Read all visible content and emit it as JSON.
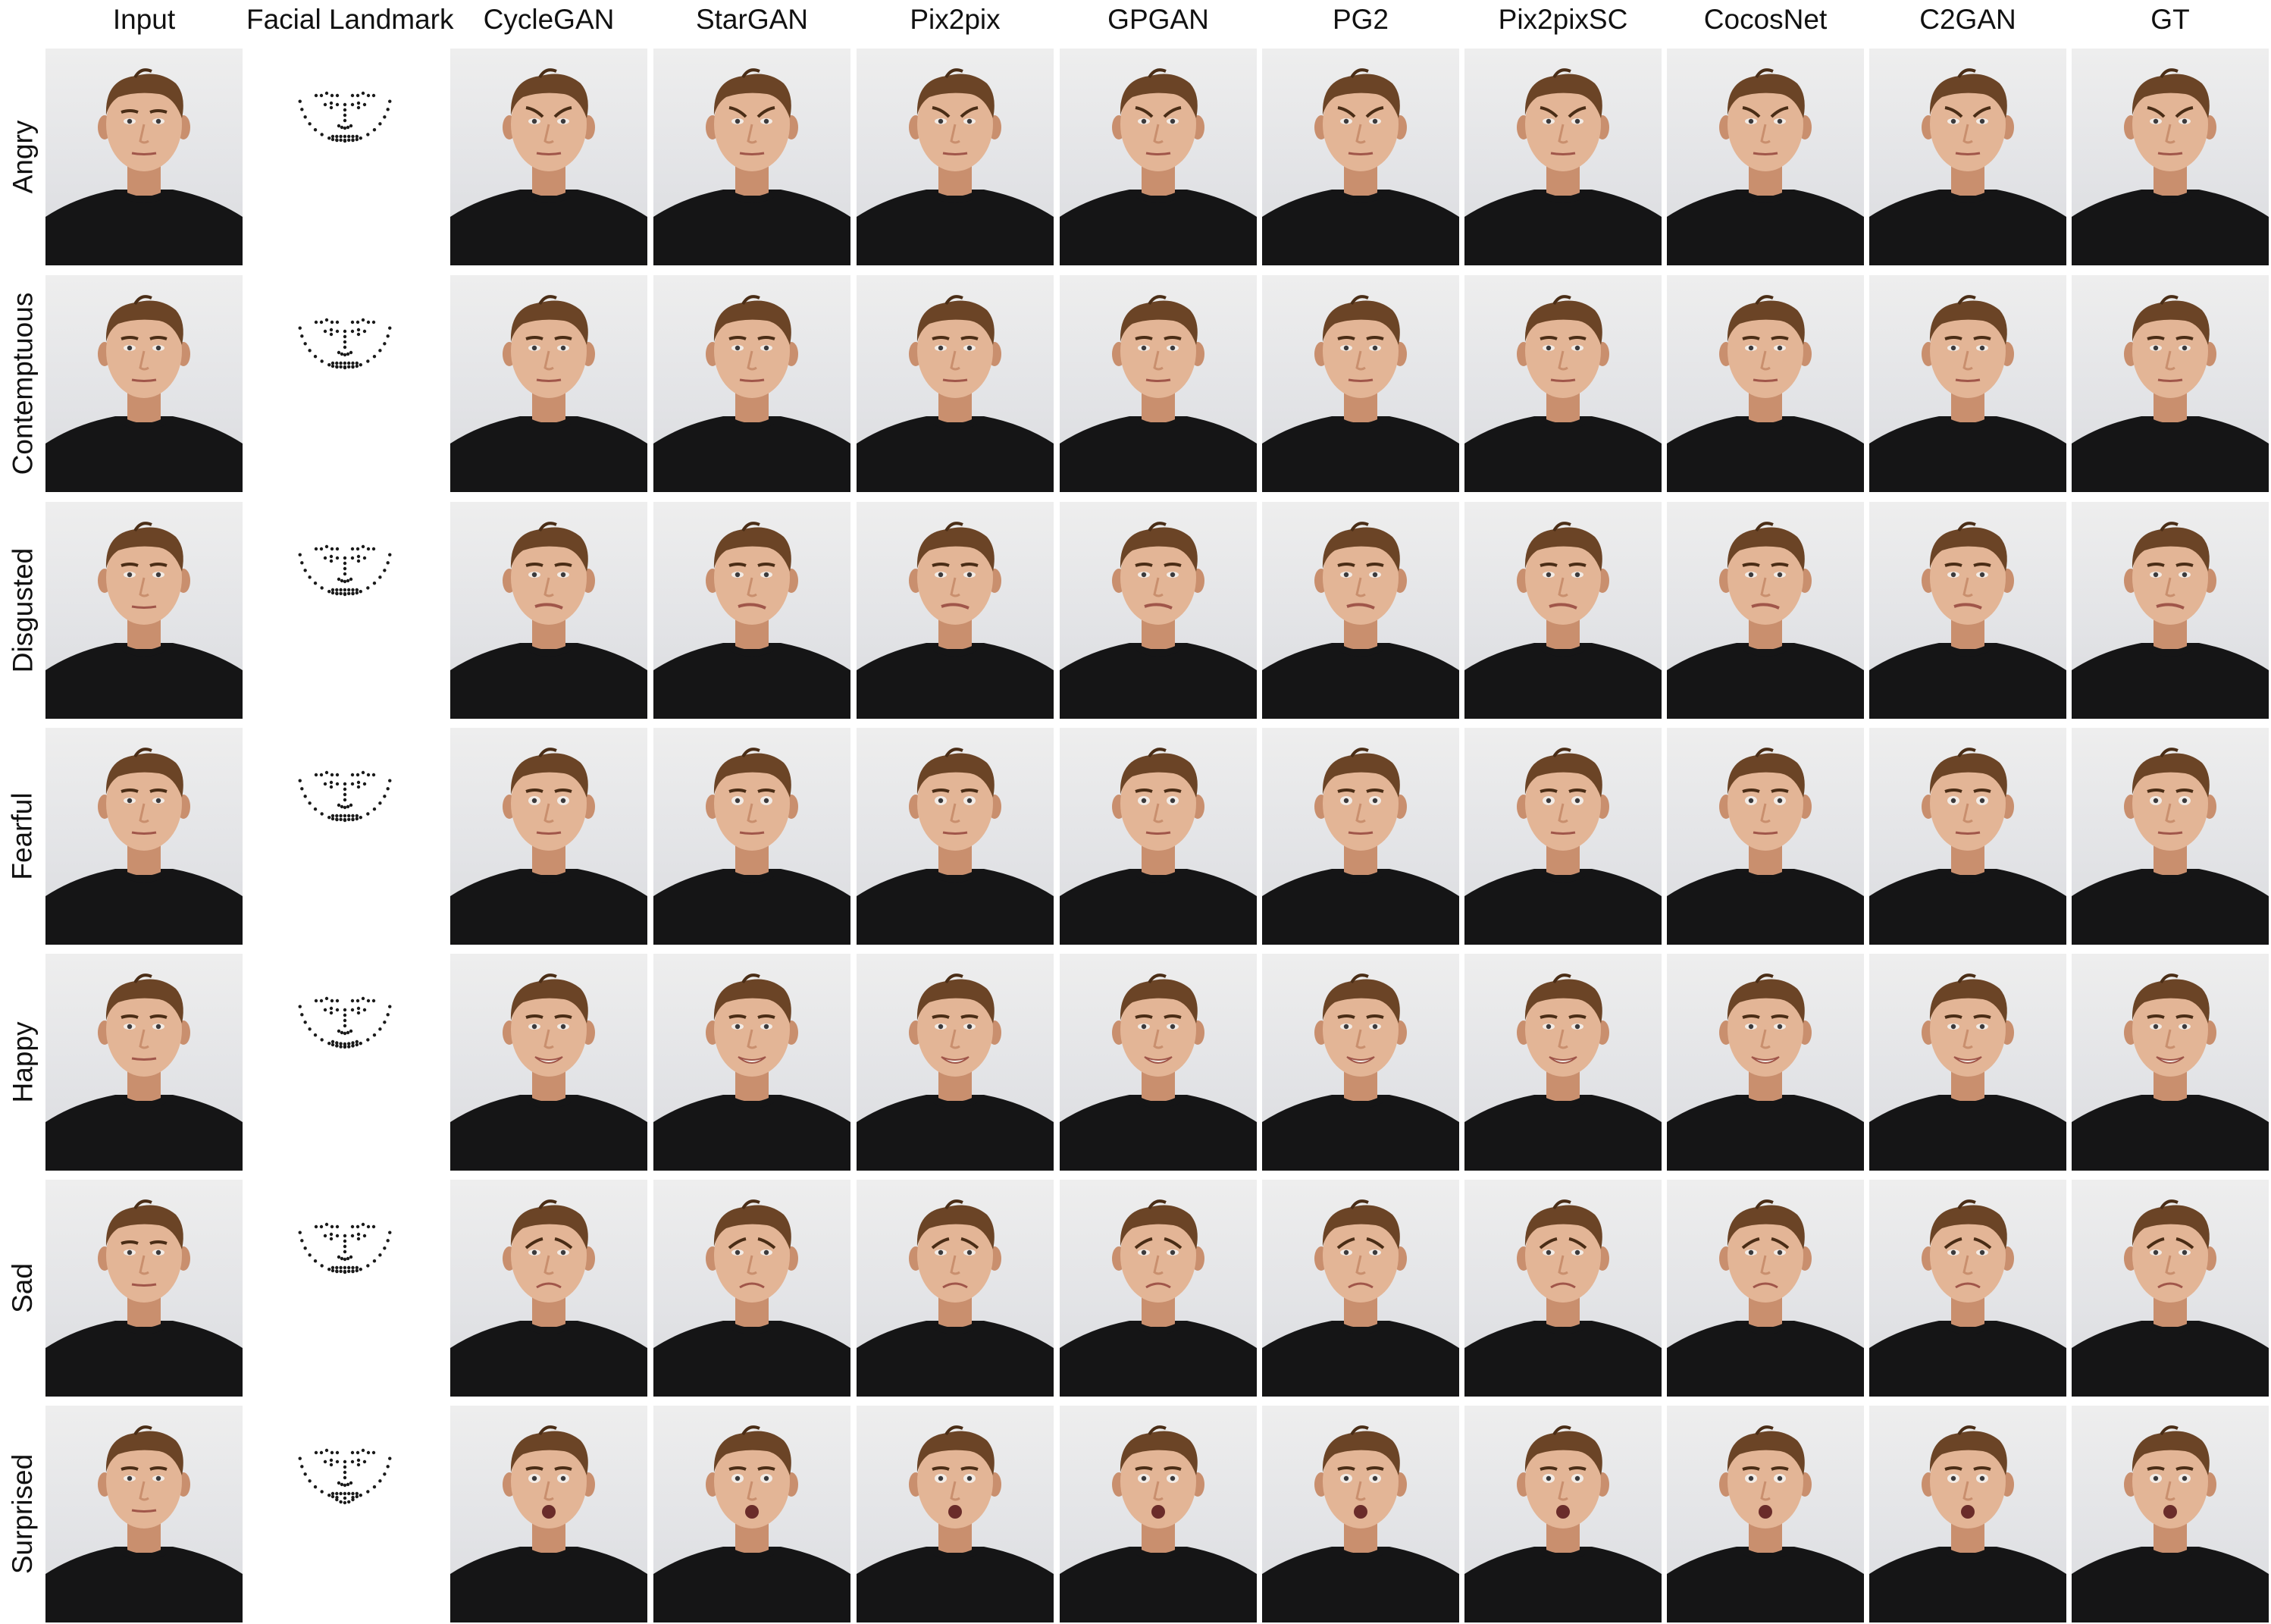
{
  "figure": {
    "columns": [
      "Input",
      "Facial Landmark",
      "CycleGAN",
      "StarGAN",
      "Pix2pix",
      "GPGAN",
      "PG2",
      "Pix2pixSC",
      "CocosNet",
      "C2GAN",
      "GT"
    ],
    "rows": [
      "Angry",
      "Contemptuous",
      "Disgusted",
      "Fearful",
      "Happy",
      "Sad",
      "Surprised"
    ]
  },
  "colors": {
    "skin": "#e3b596",
    "skin_shadow": "#c98f6e",
    "hair": "#6b4426",
    "hair_dark": "#4a2d16",
    "shirt": "#151516",
    "landmark_dot": "#1a1a1a"
  }
}
